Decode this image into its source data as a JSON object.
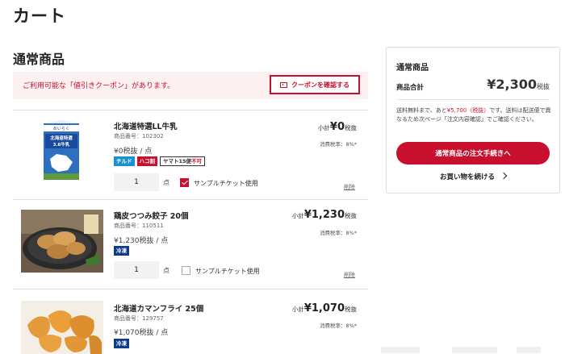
{
  "page": {
    "title": "カート"
  },
  "section": {
    "title": "通常商品"
  },
  "coupon": {
    "message": "ご利用可能な「値引きクーポン」があります。",
    "button_label": "クーポンを確認する"
  },
  "items": [
    {
      "name": "北海道特選LL牛乳",
      "code": "商品番号：102302",
      "unit_price": "¥0税抜 / 点",
      "tags": [
        "チルド",
        "ハコ割",
        "ヤマト15便",
        "不可"
      ],
      "quantity": "1",
      "qty_unit": "点",
      "ticket_label": "サンプルチケット使用",
      "ticket_checked": true,
      "subtotal_prefix": "小計",
      "subtotal": "¥0",
      "subtotal_suffix": "税抜",
      "tax_rate": "消費税率：8%*",
      "delete_label": "削除",
      "image_label_1": "めいらく",
      "image_label_2": "北海道特選",
      "image_label_3": "3.6牛乳"
    },
    {
      "name": "鶏皮つつみ餃子 20個",
      "code": "商品番号：110511",
      "unit_price": "¥1,230税抜 / 点",
      "tags": [
        "冷凍"
      ],
      "quantity": "1",
      "qty_unit": "点",
      "ticket_label": "サンプルチケット使用",
      "ticket_checked": false,
      "subtotal_prefix": "小計",
      "subtotal": "¥1,230",
      "subtotal_suffix": "税抜",
      "tax_rate": "消費税率：8%*",
      "delete_label": "削除"
    },
    {
      "name": "北海道カマンフライ 25個",
      "code": "商品番号：129757",
      "unit_price": "¥1,070税抜 / 点",
      "tags": [
        "冷凍"
      ],
      "subtotal_prefix": "小計",
      "subtotal": "¥1,070",
      "subtotal_suffix": "税抜",
      "tax_rate": "消費税率：8%*"
    }
  ],
  "summary": {
    "title": "通常商品",
    "total_label": "商品合計",
    "total_value": "¥2,300",
    "total_suffix": "税抜",
    "note_1": "送料無料まで、あと",
    "note_amount": "¥5,700（税抜）",
    "note_2": "です。送料は配送便で異なるため次ページ「注文内容確認」でご確認ください。",
    "checkout_label": "通常商品の注文手続きへ",
    "continue_label": "お買い物を続ける"
  },
  "colors": {
    "accent": "#c8102e",
    "tag_blue": "#1a8fd3",
    "tag_navy": "#0d3c8c"
  }
}
